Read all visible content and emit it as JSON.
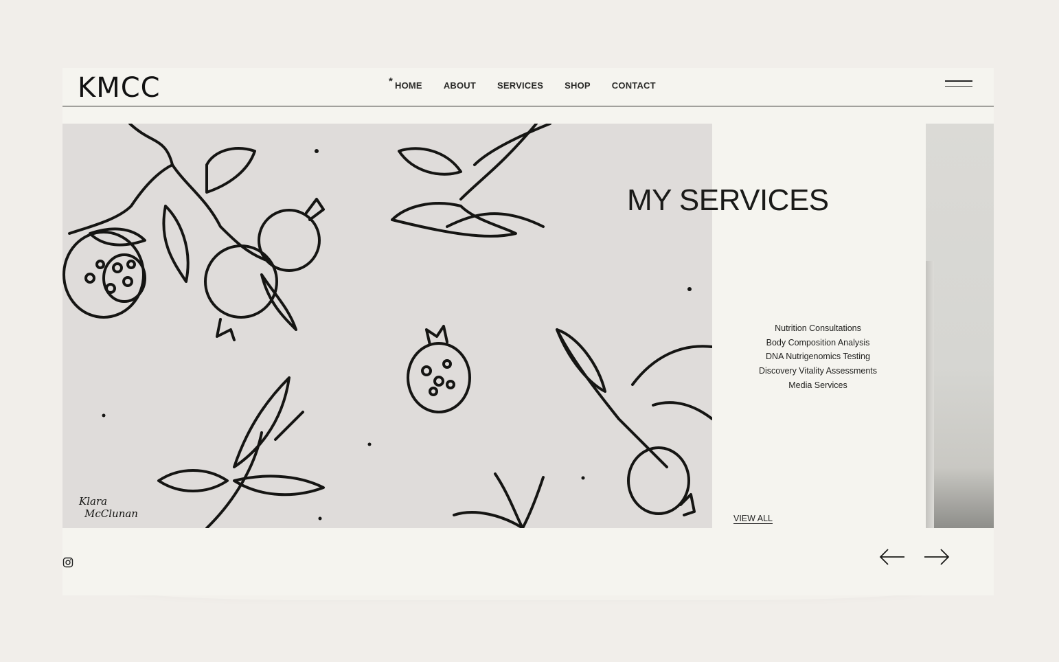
{
  "brand": {
    "logo_text": "KMCC"
  },
  "nav": {
    "items": [
      {
        "label": "HOME",
        "active_marker": "*"
      },
      {
        "label": "ABOUT"
      },
      {
        "label": "SERVICES"
      },
      {
        "label": "SHOP"
      },
      {
        "label": "CONTACT"
      }
    ],
    "menu_icon": "hamburger-icon"
  },
  "hero": {
    "image_signature": "Klara McClunan",
    "title": "MY SERVICES",
    "services": [
      "Nutrition Consultations",
      "Body Composition Analysis",
      "DNA Nutrigenomics Testing",
      "Discovery Vitality Assessments",
      "Media Services"
    ],
    "view_all_label": "VIEW ALL"
  },
  "footer": {
    "social_icon": "instagram-icon",
    "prev_icon": "arrow-left-icon",
    "next_icon": "arrow-right-icon"
  },
  "colors": {
    "page_bg": "#f1eeea",
    "panel_bg": "#f5f4ef",
    "image_bg": "#dfdcda",
    "ink": "#1c1c1a"
  }
}
